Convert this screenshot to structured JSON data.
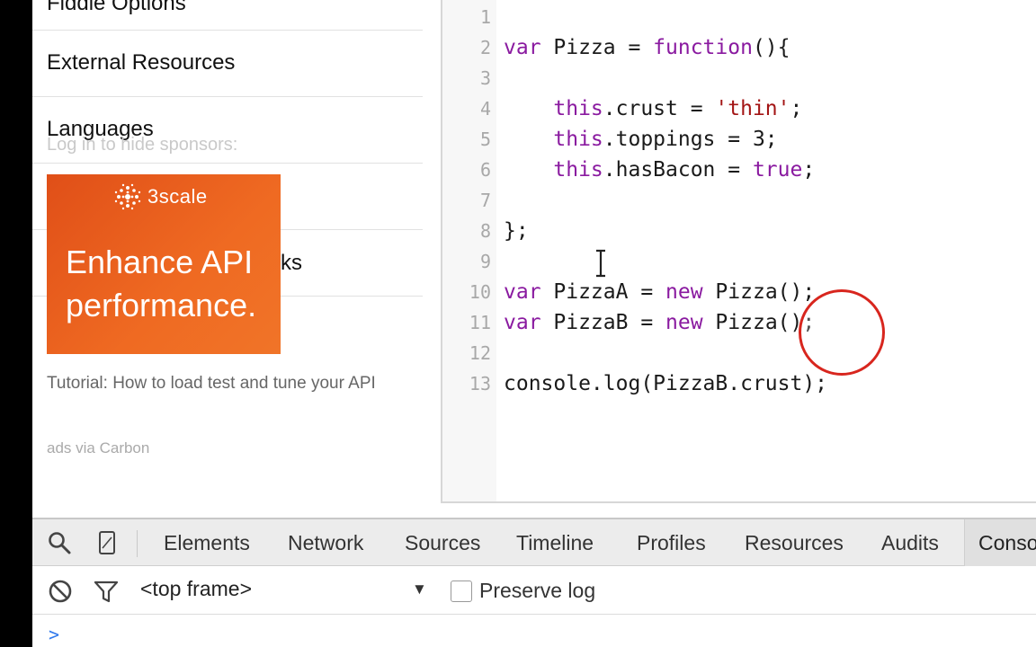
{
  "sidebar": {
    "sections": {
      "fiddle_options": "Fiddle Options",
      "external_resources": "External Resources",
      "languages": "Languages",
      "links_fragment": "ks"
    },
    "sponsor_hint": "Log in to hide sponsors:",
    "ad": {
      "brand": "3scale",
      "headline": "Enhance API performance.",
      "tagline": "Tutorial: How to load test and tune your API",
      "via": "ads via Carbon",
      "colors": {
        "start": "#e04f18",
        "end": "#f07428"
      }
    }
  },
  "editor": {
    "lines": [
      {
        "n": "1",
        "code": ""
      },
      {
        "n": "2",
        "code": "var Pizza = function(){"
      },
      {
        "n": "3",
        "code": ""
      },
      {
        "n": "4",
        "code": "    this.crust = 'thin';"
      },
      {
        "n": "5",
        "code": "    this.toppings = 3;"
      },
      {
        "n": "6",
        "code": "    this.hasBacon = true;"
      },
      {
        "n": "7",
        "code": ""
      },
      {
        "n": "8",
        "code": "};"
      },
      {
        "n": "9",
        "code": ""
      },
      {
        "n": "10",
        "code": "var PizzaA = new Pizza();"
      },
      {
        "n": "11",
        "code": "var PizzaB = new Pizza();"
      },
      {
        "n": "12",
        "code": ""
      },
      {
        "n": "13",
        "code": "console.log(PizzaB.crust);"
      }
    ],
    "keyword_color": "#8a1aa0",
    "string_color": "#a31515"
  },
  "devtools": {
    "tabs": [
      "Elements",
      "Network",
      "Sources",
      "Timeline",
      "Profiles",
      "Resources",
      "Audits",
      "Conso"
    ],
    "active_tab": "Conso",
    "frame_select": "<top frame>",
    "preserve_log": "Preserve log",
    "preserve_log_checked": false,
    "prompt": ">"
  },
  "icons": [
    "search-icon",
    "device-mode-icon",
    "clear-console-icon",
    "filter-icon",
    "dropdown-arrow-icon"
  ]
}
